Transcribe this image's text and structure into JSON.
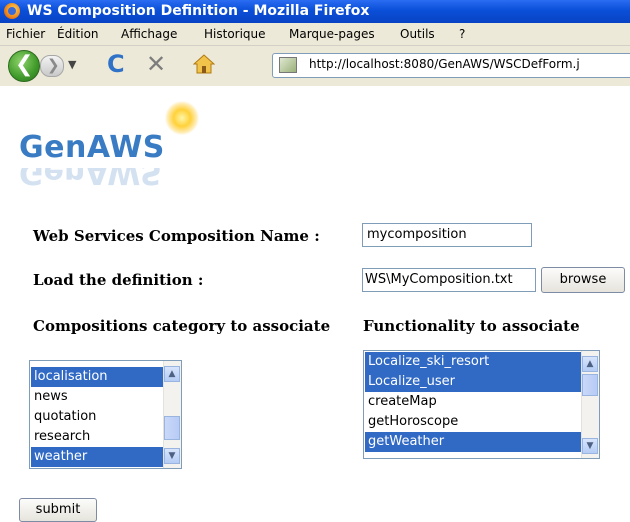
{
  "window": {
    "title": "WS Composition Definition - Mozilla Firefox"
  },
  "menu": [
    "Fichier",
    "Édition",
    "Affichage",
    "Historique",
    "Marque-pages",
    "Outils",
    "?"
  ],
  "toolbar": {
    "url": "http://localhost:8080/GenAWS/WSCDefForm.j"
  },
  "logo": {
    "text": "GenAWS"
  },
  "form": {
    "name_label": "Web Services Composition Name :",
    "name_value": "mycomposition",
    "load_label": "Load the definition :",
    "file_value": "WS\\MyComposition.txt",
    "browse_label": "browse",
    "category_label": "Compositions category to associate",
    "functionality_label": "Functionality to associate",
    "submit_label": "submit",
    "categories": [
      {
        "label": "localisation",
        "selected": true
      },
      {
        "label": "news",
        "selected": false
      },
      {
        "label": "quotation",
        "selected": false
      },
      {
        "label": "research",
        "selected": false
      },
      {
        "label": "weather",
        "selected": true
      }
    ],
    "functionalities": [
      {
        "label": "Localize_ski_resort",
        "selected": true
      },
      {
        "label": "Localize_user",
        "selected": true
      },
      {
        "label": "createMap",
        "selected": false
      },
      {
        "label": "getHoroscope",
        "selected": false
      },
      {
        "label": "getWeather",
        "selected": true
      }
    ]
  },
  "colors": {
    "titlebar": "#0a4fd8",
    "selection": "#316ac5",
    "logo": "#3a7cc4"
  }
}
